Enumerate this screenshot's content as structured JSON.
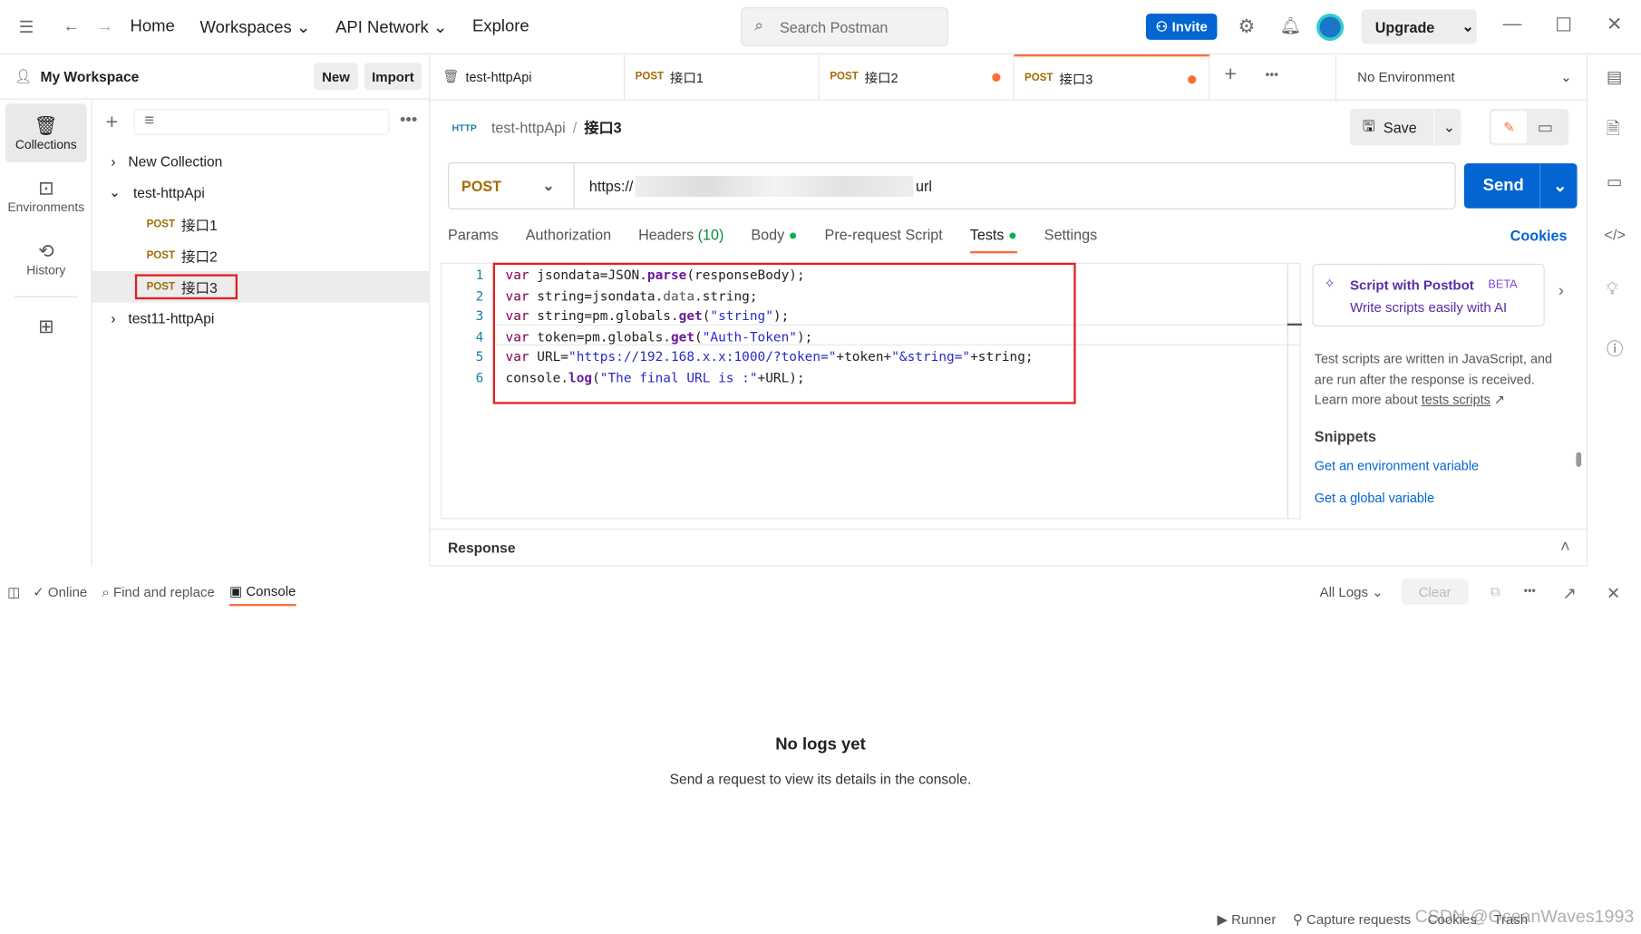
{
  "topbar": {
    "home": "Home",
    "workspaces": "Workspaces",
    "api_network": "API Network",
    "explore": "Explore",
    "search_placeholder": "Search Postman",
    "invite": "Invite",
    "upgrade": "Upgrade"
  },
  "workspace": {
    "title": "My Workspace",
    "new": "New",
    "import": "Import"
  },
  "rail": [
    {
      "label": "Collections",
      "icon": "collections-icon"
    },
    {
      "label": "Environments",
      "icon": "environments-icon"
    },
    {
      "label": "History",
      "icon": "history-icon"
    }
  ],
  "tree": {
    "new_collection": "New Collection",
    "collection": "test-httpApi",
    "requests": [
      {
        "method": "POST",
        "name": "接口1"
      },
      {
        "method": "POST",
        "name": "接口2"
      },
      {
        "method": "POST",
        "name": "接口3"
      }
    ],
    "collection2": "test11-httpApi"
  },
  "tabs": [
    {
      "label": "test-httpApi"
    },
    {
      "method": "POST",
      "label": "接口1"
    },
    {
      "method": "POST",
      "label": "接口2",
      "unsaved": true
    },
    {
      "method": "POST",
      "label": "接口3",
      "unsaved": true,
      "active": true
    }
  ],
  "environment": "No Environment",
  "breadcrumb": {
    "badge": "HTTP",
    "parent": "test-httpApi",
    "current": "接口3"
  },
  "save": "Save",
  "request": {
    "method": "POST",
    "url_prefix": "https://",
    "url_suffix": "url",
    "send": "Send"
  },
  "req_tabs": {
    "params": "Params",
    "authorization": "Authorization",
    "headers": "Headers",
    "headers_count": "(10)",
    "body": "Body",
    "prerequest": "Pre-request Script",
    "tests": "Tests",
    "settings": "Settings",
    "cookies": "Cookies"
  },
  "code": [
    "var jsondata=JSON.parse(responseBody);",
    "var string=jsondata.data.string;",
    "var string=pm.globals.get(\"string\");",
    "var token=pm.globals.get(\"Auth-Token\");",
    "var URL=\"https://192.168.x.x:1000/?token=\"+token+\"&string=\"+string;",
    "console.log(\"The final URL is :\"+URL);"
  ],
  "postbot": {
    "title": "Script with Postbot",
    "beta": "BETA",
    "subtitle": "Write scripts easily with AI"
  },
  "help": {
    "text": "Test scripts are written in JavaScript, and are run after the response is received.",
    "learn": "Learn more about ",
    "link": "tests scripts",
    "arrow": "↗"
  },
  "snippets": {
    "title": "Snippets",
    "items": [
      "Get an environment variable",
      "Get a global variable"
    ]
  },
  "response": "Response",
  "console": {
    "online": "Online",
    "find": "Find and replace",
    "console": "Console",
    "all_logs": "All Logs",
    "clear": "Clear",
    "empty_title": "No logs yet",
    "empty_sub": "Send a request to view its details in the console."
  },
  "footer": {
    "runner": "Runner",
    "capture": "Capture requests",
    "cookies": "Cookies",
    "trash": "Trash",
    "watermark": "CSDN @OceanWaves1993"
  },
  "colors": {
    "accent": "#0265d2",
    "unsaved": "#ff6c37",
    "highlight": "#e02020"
  }
}
